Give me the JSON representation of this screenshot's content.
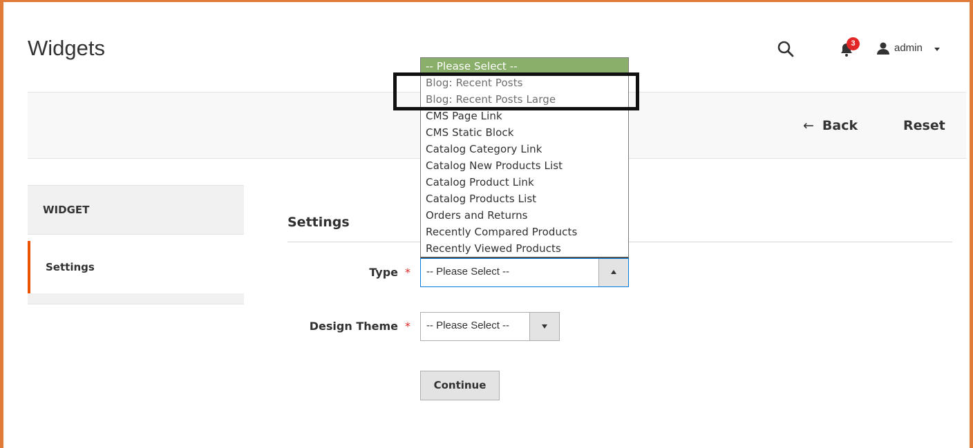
{
  "header": {
    "title": "Widgets",
    "notification_count": "3",
    "user_name": "admin"
  },
  "actions": {
    "back_label": "Back",
    "back_arrow": "←",
    "reset_label": "Reset"
  },
  "sidebar": {
    "heading": "WIDGET",
    "items": [
      {
        "label": "Settings",
        "active": true
      }
    ]
  },
  "form": {
    "section_title": "Settings",
    "type_label": "Type",
    "type_value": "-- Please Select --",
    "design_theme_label": "Design Theme",
    "design_theme_value": "-- Please Select --",
    "required_marker": "*",
    "continue_label": "Continue"
  },
  "type_dropdown": {
    "options": [
      "-- Please Select --",
      "Blog: Recent Posts",
      "Blog: Recent Posts Large",
      "CMS Page Link",
      "CMS Static Block",
      "Catalog Category Link",
      "Catalog New Products List",
      "Catalog Product Link",
      "Catalog Products List",
      "Orders and Returns",
      "Recently Compared Products",
      "Recently Viewed Products"
    ],
    "selected_index": 0
  },
  "colors": {
    "frame": "#e07b39",
    "accent": "#eb5202",
    "selected_option": "#8aaf6a",
    "badge": "#e22626",
    "focus_border": "#007bdb"
  }
}
